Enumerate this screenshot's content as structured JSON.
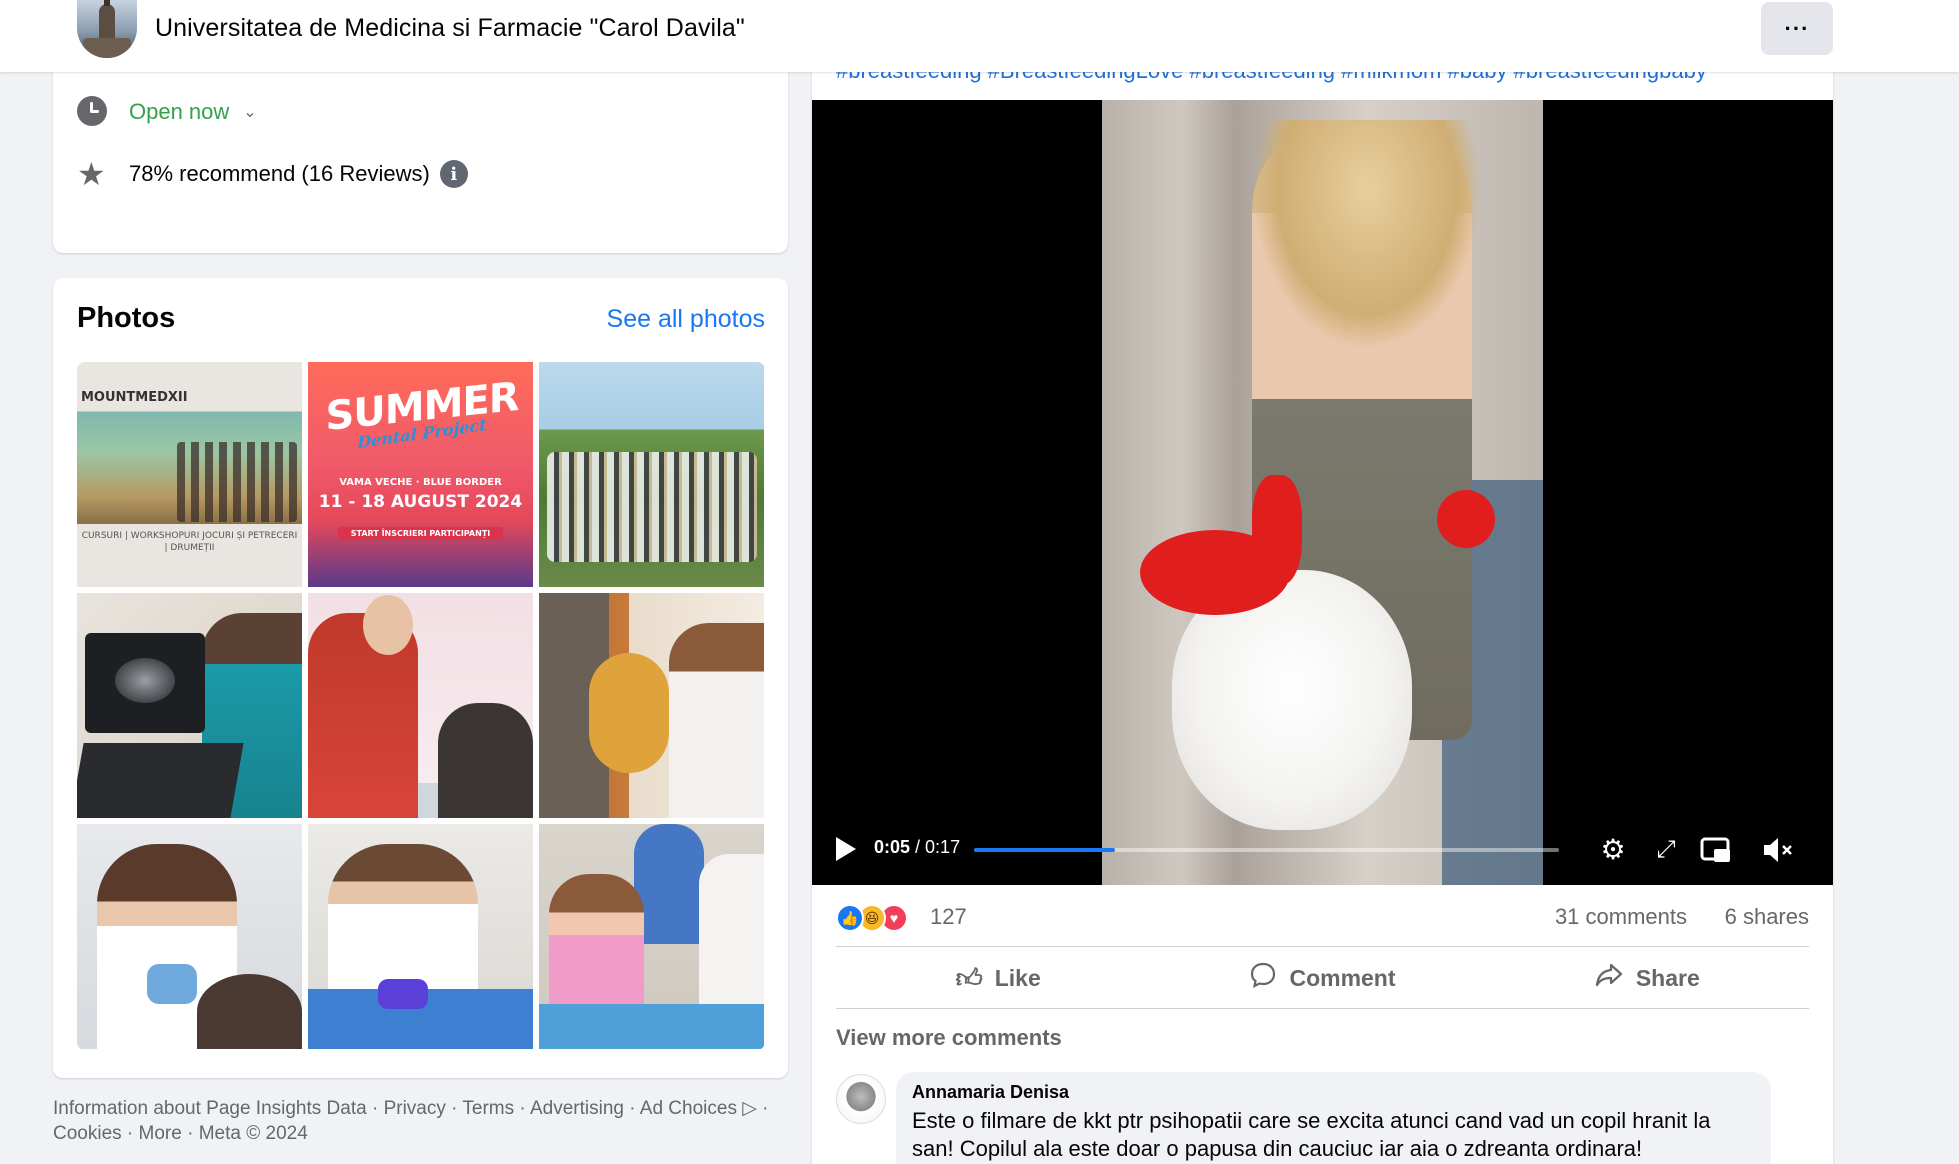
{
  "header": {
    "page_name": "Universitatea de Medicina si Farmacie \"Carol Davila\"",
    "more_label": "···"
  },
  "info": {
    "open_status": "Open now",
    "recommend_text": "78% recommend (16 Reviews)",
    "info_glyph": "i"
  },
  "photos": {
    "title": "Photos",
    "see_all": "See all photos",
    "tiles": [
      {
        "icon": "mountain-hike-photo",
        "text_a": "MOUNTMEDXII",
        "text_b": "CURSURI | WORKSHOPURI JOCURI ȘI PETRECERI | DRUMEȚII"
      },
      {
        "icon": "summer-event-poster",
        "text_a": "SUMMER",
        "text_b": "Dental Project",
        "text_c": "VAMA VECHE · BLUE BORDER",
        "text_d": "11 - 18 AUGUST 2024",
        "text_e": "START ÎNSCRIERI PARTICIPANȚI"
      },
      {
        "icon": "group-photo"
      },
      {
        "icon": "ultrasound-photo"
      },
      {
        "icon": "blood-pressure-photo"
      },
      {
        "icon": "child-exam-photo"
      },
      {
        "icon": "dental-exam-photo"
      },
      {
        "icon": "clinic-table-photo"
      },
      {
        "icon": "kids-activity-photo"
      }
    ]
  },
  "footer": {
    "line1": "Information about Page Insights Data · Privacy · Terms · Advertising · Ad Choices ▷ ·",
    "line2": "Cookies · More · Meta © 2024"
  },
  "post": {
    "hashtags": "#breastfeeding #BreastfeedingLove #breastfeeding #milkmom #baby #breastfeedingbaby",
    "video": {
      "time_current": "0:05",
      "time_total": "/ 0:17",
      "progress": 0.2405
    },
    "reactions_count": "127",
    "comments_count": "31 comments",
    "shares_count": "6 shares",
    "actions": {
      "like": "Like",
      "comment": "Comment",
      "share": "Share"
    },
    "view_more": "View more comments",
    "comment": {
      "author": "Annamaria Denisa",
      "text": "Este o filmare de kkt ptr psihopatii care se excita atunci cand vad un copil hranit la san! Copilul ala este doar o papusa din cauciuc iar aia o zdreanta ordinara!"
    }
  },
  "colors": {
    "accent": "#1877f2",
    "open_green": "#31a24c",
    "secondary_text": "#65676b",
    "censor_red": "#e01e1e"
  }
}
